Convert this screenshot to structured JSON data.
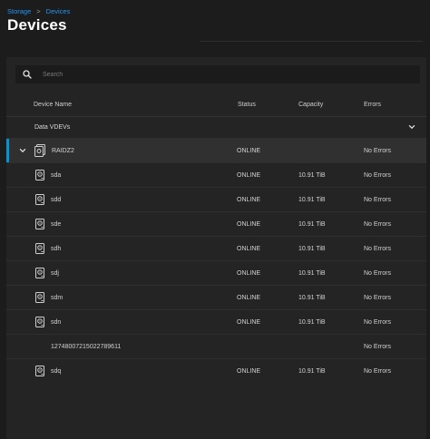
{
  "breadcrumb": {
    "items": [
      "Storage",
      "Devices"
    ],
    "separator": ">"
  },
  "page": {
    "title": "Devices"
  },
  "search": {
    "placeholder": "Search",
    "value": ""
  },
  "table": {
    "headers": {
      "device_name": "Device Name",
      "status": "Status",
      "capacity": "Capacity",
      "errors": "Errors"
    },
    "group": {
      "label": "Data VDEVs",
      "icon": "chevron-down-icon"
    },
    "vdev": {
      "name": "RAIDZ2",
      "status": "ONLINE",
      "capacity": "",
      "errors": "No Errors",
      "icon": "raid-icon",
      "selected": true
    },
    "disks": [
      {
        "name": "sda",
        "status": "ONLINE",
        "capacity": "10.91 TiB",
        "errors": "No Errors",
        "icon": "hard-disk-icon"
      },
      {
        "name": "sdd",
        "status": "ONLINE",
        "capacity": "10.91 TiB",
        "errors": "No Errors",
        "icon": "hard-disk-icon"
      },
      {
        "name": "sde",
        "status": "ONLINE",
        "capacity": "10.91 TiB",
        "errors": "No Errors",
        "icon": "hard-disk-icon"
      },
      {
        "name": "sdh",
        "status": "ONLINE",
        "capacity": "10.91 TiB",
        "errors": "No Errors",
        "icon": "hard-disk-icon"
      },
      {
        "name": "sdj",
        "status": "ONLINE",
        "capacity": "10.91 TiB",
        "errors": "No Errors",
        "icon": "hard-disk-icon"
      },
      {
        "name": "sdm",
        "status": "ONLINE",
        "capacity": "10.91 TiB",
        "errors": "No Errors",
        "icon": "hard-disk-icon"
      },
      {
        "name": "sdn",
        "status": "ONLINE",
        "capacity": "10.91 TiB",
        "errors": "No Errors",
        "icon": "hard-disk-icon"
      },
      {
        "name": "12748007215022789611",
        "status": "",
        "capacity": "",
        "errors": "No Errors",
        "icon": ""
      },
      {
        "name": "sdq",
        "status": "ONLINE",
        "capacity": "10.91 TiB",
        "errors": "No Errors",
        "icon": "hard-disk-icon"
      }
    ]
  },
  "colors": {
    "accent": "#0095d5",
    "link": "#2196f3",
    "background": "#1c1c1c",
    "card": "#242424",
    "selected_row": "#303030"
  }
}
